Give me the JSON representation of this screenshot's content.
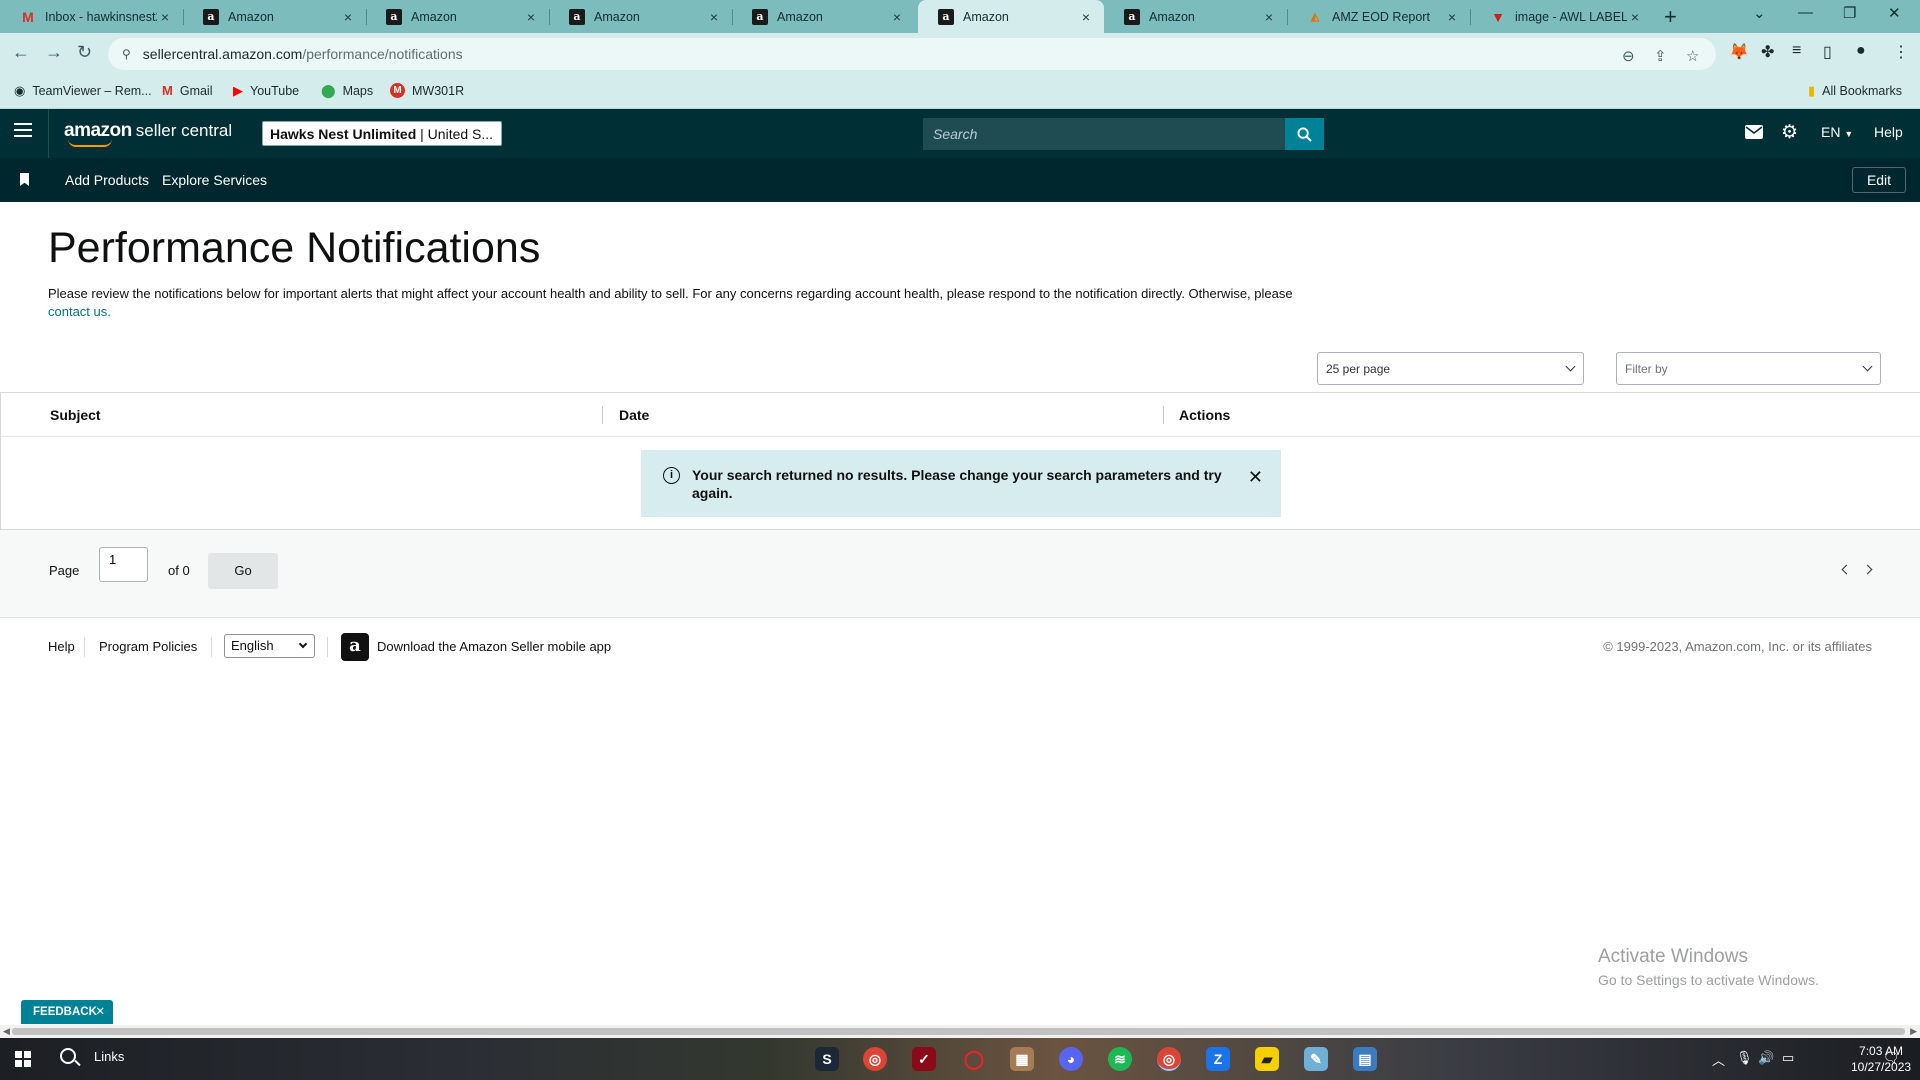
{
  "browser": {
    "tabs": [
      {
        "title": "Inbox - hawkinsnest2...",
        "icon": "gmail-icon"
      },
      {
        "title": "Amazon",
        "icon": "amazon-icon"
      },
      {
        "title": "Amazon",
        "icon": "amazon-icon"
      },
      {
        "title": "Amazon",
        "icon": "amazon-icon"
      },
      {
        "title": "Amazon",
        "icon": "amazon-icon"
      },
      {
        "title": "Amazon",
        "icon": "amazon-icon",
        "active": true
      },
      {
        "title": "Amazon",
        "icon": "amazon-icon"
      },
      {
        "title": "AMZ EOD Report",
        "icon": "sheets-icon"
      },
      {
        "title": "image - AWL LABEL",
        "icon": "awl-icon"
      }
    ],
    "url_host": "sellercentral.amazon.com",
    "url_path": "/performance/notifications",
    "bookmarks": [
      {
        "label": "TeamViewer – Rem...",
        "icon": "teamviewer-icon"
      },
      {
        "label": "Gmail",
        "icon": "gmail-icon"
      },
      {
        "label": "YouTube",
        "icon": "youtube-icon"
      },
      {
        "label": "Maps",
        "icon": "maps-icon"
      },
      {
        "label": "MW301R",
        "icon": "mw-icon"
      }
    ],
    "all_bookmarks": "All Bookmarks"
  },
  "header": {
    "logo_amazon": "amazon",
    "logo_rest": "seller central",
    "account_bold": "Hawks Nest Unlimited",
    "account_rest": " | United S...",
    "search_placeholder": "Search",
    "language": "EN",
    "help": "Help"
  },
  "nav": {
    "links": [
      "Add Products",
      "Explore Services"
    ],
    "edit": "Edit"
  },
  "page": {
    "title": "Performance Notifications",
    "description": "Please review the notifications below for important alerts that might affect your account health and ability to sell. For any concerns regarding account health, please respond to the notification directly. Otherwise, please ",
    "contact_link": "contact us.",
    "per_page": "25 per page",
    "filter_placeholder": "Filter by"
  },
  "table": {
    "columns": [
      "Subject",
      "Date",
      "Actions"
    ],
    "no_results": "Your search returned no results. Please change your search parameters and try again."
  },
  "pager": {
    "page_label": "Page",
    "current_page": "1",
    "of_label": "of 0",
    "go": "Go"
  },
  "footer": {
    "help": "Help",
    "program_policies": "Program Policies",
    "language": "English",
    "download_app": "Download the Amazon Seller mobile app",
    "copyright": "© 1999-2023, Amazon.com, Inc. or its affiliates"
  },
  "overlay": {
    "activate_title": "Activate Windows",
    "activate_sub": "Go to Settings to activate Windows.",
    "feedback": "FEEDBACK"
  },
  "taskbar": {
    "search_label": "Links",
    "time": "7:03 AM",
    "date": "10/27/2023"
  },
  "colors": {
    "header_bg": "#002f36",
    "nav_bg": "#00272d",
    "accent": "#008296",
    "link": "#007185",
    "alert_bg": "#d7ecee"
  }
}
